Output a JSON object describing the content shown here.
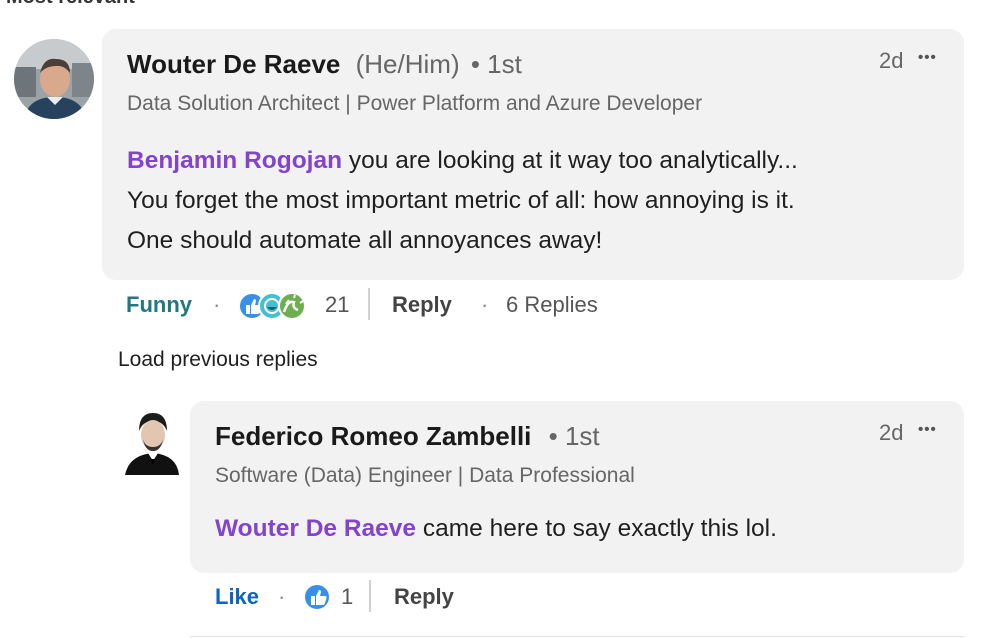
{
  "section_header": "Most relevant",
  "comment": {
    "author": "Wouter De Raeve",
    "pronouns": "(He/Him)",
    "degree": "• 1st",
    "headline": "Data Solution Architect | Power Platform and Azure Developer",
    "time": "2d",
    "more": "•••",
    "mention": "Benjamin Rogojan",
    "text_line1": " you are looking at it way too analytically...",
    "text_line2": "You forget the most important metric of all: how annoying is it.",
    "text_line3": "One should automate all annoyances away!",
    "reaction_label": "Funny",
    "dot": "·",
    "reaction_count": "21",
    "reply_label": "Reply",
    "replies_count": "6 Replies",
    "reaction_icons": [
      "like-icon",
      "funny-icon",
      "celebrate-icon"
    ]
  },
  "load_previous": "Load previous replies",
  "reply": {
    "author": "Federico Romeo Zambelli",
    "degree": "• 1st",
    "headline": "Software (Data) Engineer | Data Professional",
    "time": "2d",
    "more": "•••",
    "mention": "Wouter De Raeve",
    "text": " came here to say exactly this lol.",
    "reaction_label": "Like",
    "dot": "·",
    "reaction_count": "1",
    "reply_label": "Reply",
    "reaction_icons": [
      "like-icon"
    ]
  },
  "colors": {
    "mention": "#8344cc",
    "funny_label": "#1f7a7f",
    "like_label": "#0a66c2",
    "bubble": "#f2f2f2",
    "secondary_text": "#666666"
  }
}
